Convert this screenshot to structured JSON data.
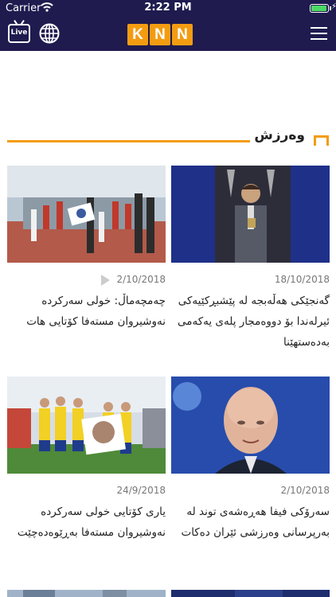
{
  "status_bar": {
    "carrier": "Carrier",
    "time": "2:22 PM"
  },
  "header": {
    "live_label": "Live",
    "logo_letters": [
      "K",
      "N",
      "N"
    ]
  },
  "section": {
    "title": "وەرزش"
  },
  "articles": [
    {
      "date": "18/10/2018",
      "headline": "گەنجێکی هەڵەبجە لە پێشبڕکێیەکی ئیرلەندا بۆ دووەمجار پلەی یەکەمی بەدەستهێنا",
      "image_icon": "man-holding-trophy-photo"
    },
    {
      "date": "2/10/2018",
      "headline": "چەمچەماڵ: خولی سەرکردە نەوشیروان مستەفا کۆتایی هات",
      "image_icon": "football-ceremony-photo",
      "has_video": true
    },
    {
      "date": "2/10/2018",
      "headline": "سەرۆکی فیفا هەڕەشەی توند لە بەرپرسانی وەرزشی ئێران دەکات",
      "image_icon": "fifa-president-photo"
    },
    {
      "date": "24/9/2018",
      "headline": "یاری کۆتایی خولی سەرکردە نەوشیروان مستەفا بەڕێوەدەچێت",
      "image_icon": "football-team-portrait-photo"
    }
  ]
}
